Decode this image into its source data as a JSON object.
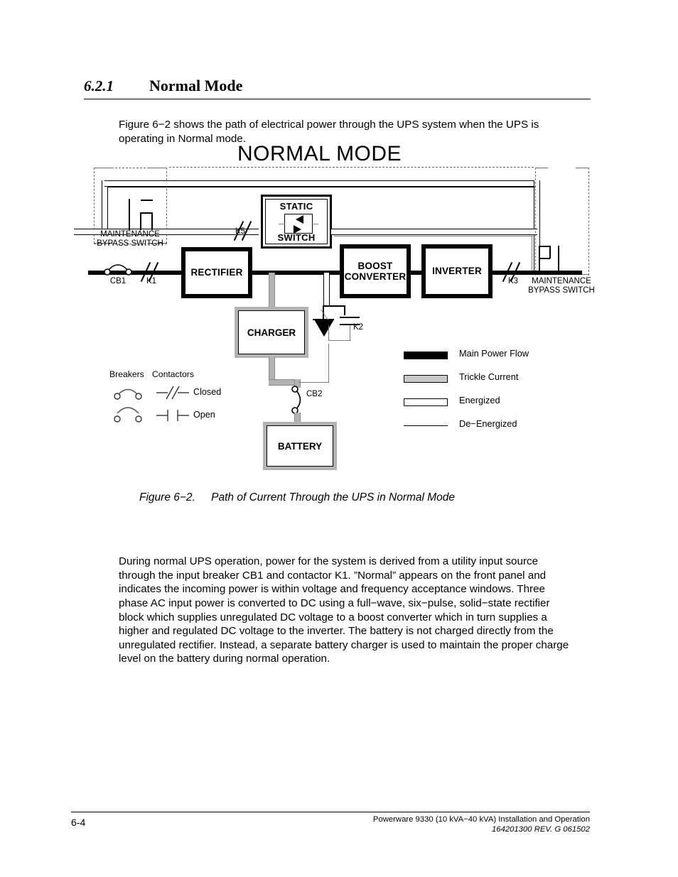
{
  "section": {
    "number": "6.2.1",
    "title": "Normal Mode"
  },
  "intro_paragraph": "Figure 6−2 shows the path of electrical power through the UPS system when the UPS is operating in Normal mode.",
  "figure": {
    "diagram_title": "NORMAL MODE",
    "caption_number": "Figure 6−2.",
    "caption_text": "Path of Current Through the UPS in Normal Mode",
    "blocks": {
      "rectifier": "RECTIFIER",
      "boost_converter_line1": "BOOST",
      "boost_converter_line2": "CONVERTER",
      "inverter": "INVERTER",
      "charger": "CHARGER",
      "battery": "BATTERY",
      "static_switch_top": "STATIC",
      "static_switch_bottom": "SWITCH"
    },
    "device_labels": {
      "cb1": "CB1",
      "cb2": "CB2",
      "k1": "K1",
      "k2": "K2",
      "k3": "K3",
      "k5": "K5"
    },
    "bypass_left": {
      "line1": "MAINTENANCE",
      "line2": "BYPASS SWITCH"
    },
    "bypass_right": {
      "line1": "MAINTENANCE",
      "line2": "BYPASS SWITCH"
    },
    "legend_flows": [
      {
        "swatch": "main-power-flow",
        "label": "Main Power Flow",
        "color": "#000000"
      },
      {
        "swatch": "trickle-current",
        "label": "Trickle Current",
        "color": "#c8c8c8"
      },
      {
        "swatch": "energized",
        "label": "Energized",
        "color": "#ffffff"
      },
      {
        "swatch": "de-energized",
        "label": "De−Energized",
        "color": "#000000"
      }
    ],
    "legend_symbols": {
      "header_breakers": "Breakers",
      "header_contactors": "Contactors",
      "state_closed": "Closed",
      "state_open": "Open"
    }
  },
  "body_paragraph": "During normal UPS operation, power for the system is derived from a utility input source through the input breaker CB1 and contactor K1. ”Normal” appears on the front panel and indicates the incoming power is within voltage and frequency acceptance windows. Three phase AC input power is converted to DC using a full−wave, six−pulse, solid−state rectifier block which supplies unregulated DC voltage to a boost converter which in turn supplies a higher and regulated DC voltage to the inverter.  The battery is not charged directly from the unregulated rectifier.  Instead, a separate battery charger is used to maintain the proper charge level on the battery during normal operation.",
  "footer": {
    "page_number": "6-4",
    "document_line1": "Powerware 9330 (10 kVA−40 kVA) Installation and Operation",
    "document_line2": "164201300 REV. G  061502"
  }
}
